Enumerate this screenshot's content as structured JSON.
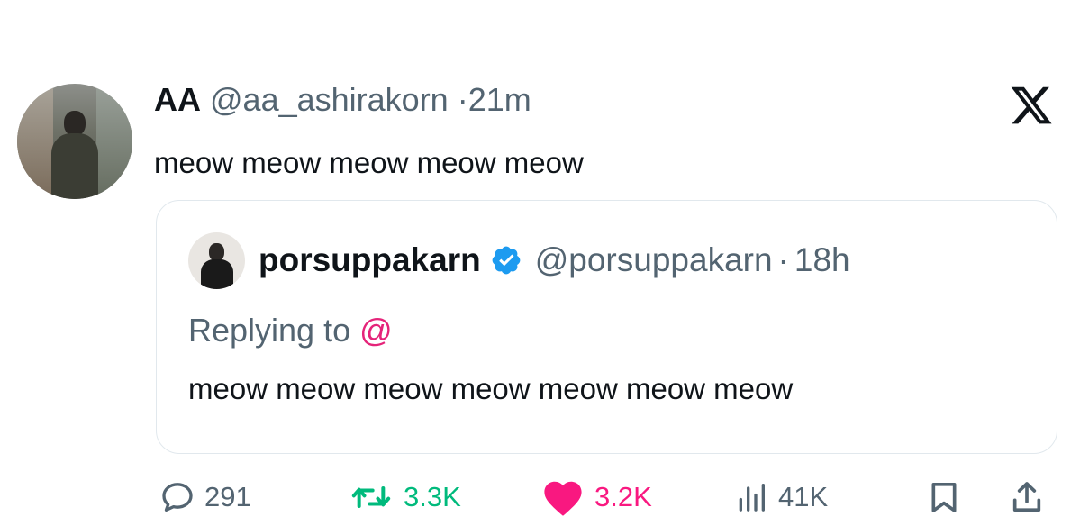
{
  "tweet": {
    "display_name": "AA",
    "handle": "@aa_ashirakorn",
    "separator": "·",
    "time": "21m",
    "text": "meow meow meow meow meow",
    "avatar_icon": "profile-photo"
  },
  "brand": {
    "logo_icon": "x-logo-icon"
  },
  "quote": {
    "display_name": "porsuppakarn",
    "verified_icon": "verified-badge-icon",
    "verified_color": "#1d9bf0",
    "handle": "@porsuppakarn",
    "separator": "·",
    "time": "18h",
    "replying_prefix": "Replying to",
    "replying_mention": "@",
    "mention_color": "#e5247a",
    "text": "meow meow meow meow meow meow meow"
  },
  "actions": {
    "reply_count": "291",
    "retweet_count": "3.3K",
    "like_count": "3.2K",
    "views_count": "41K",
    "retweet_color": "#00ba7c",
    "like_color": "#f91880",
    "muted_color": "#536471"
  }
}
